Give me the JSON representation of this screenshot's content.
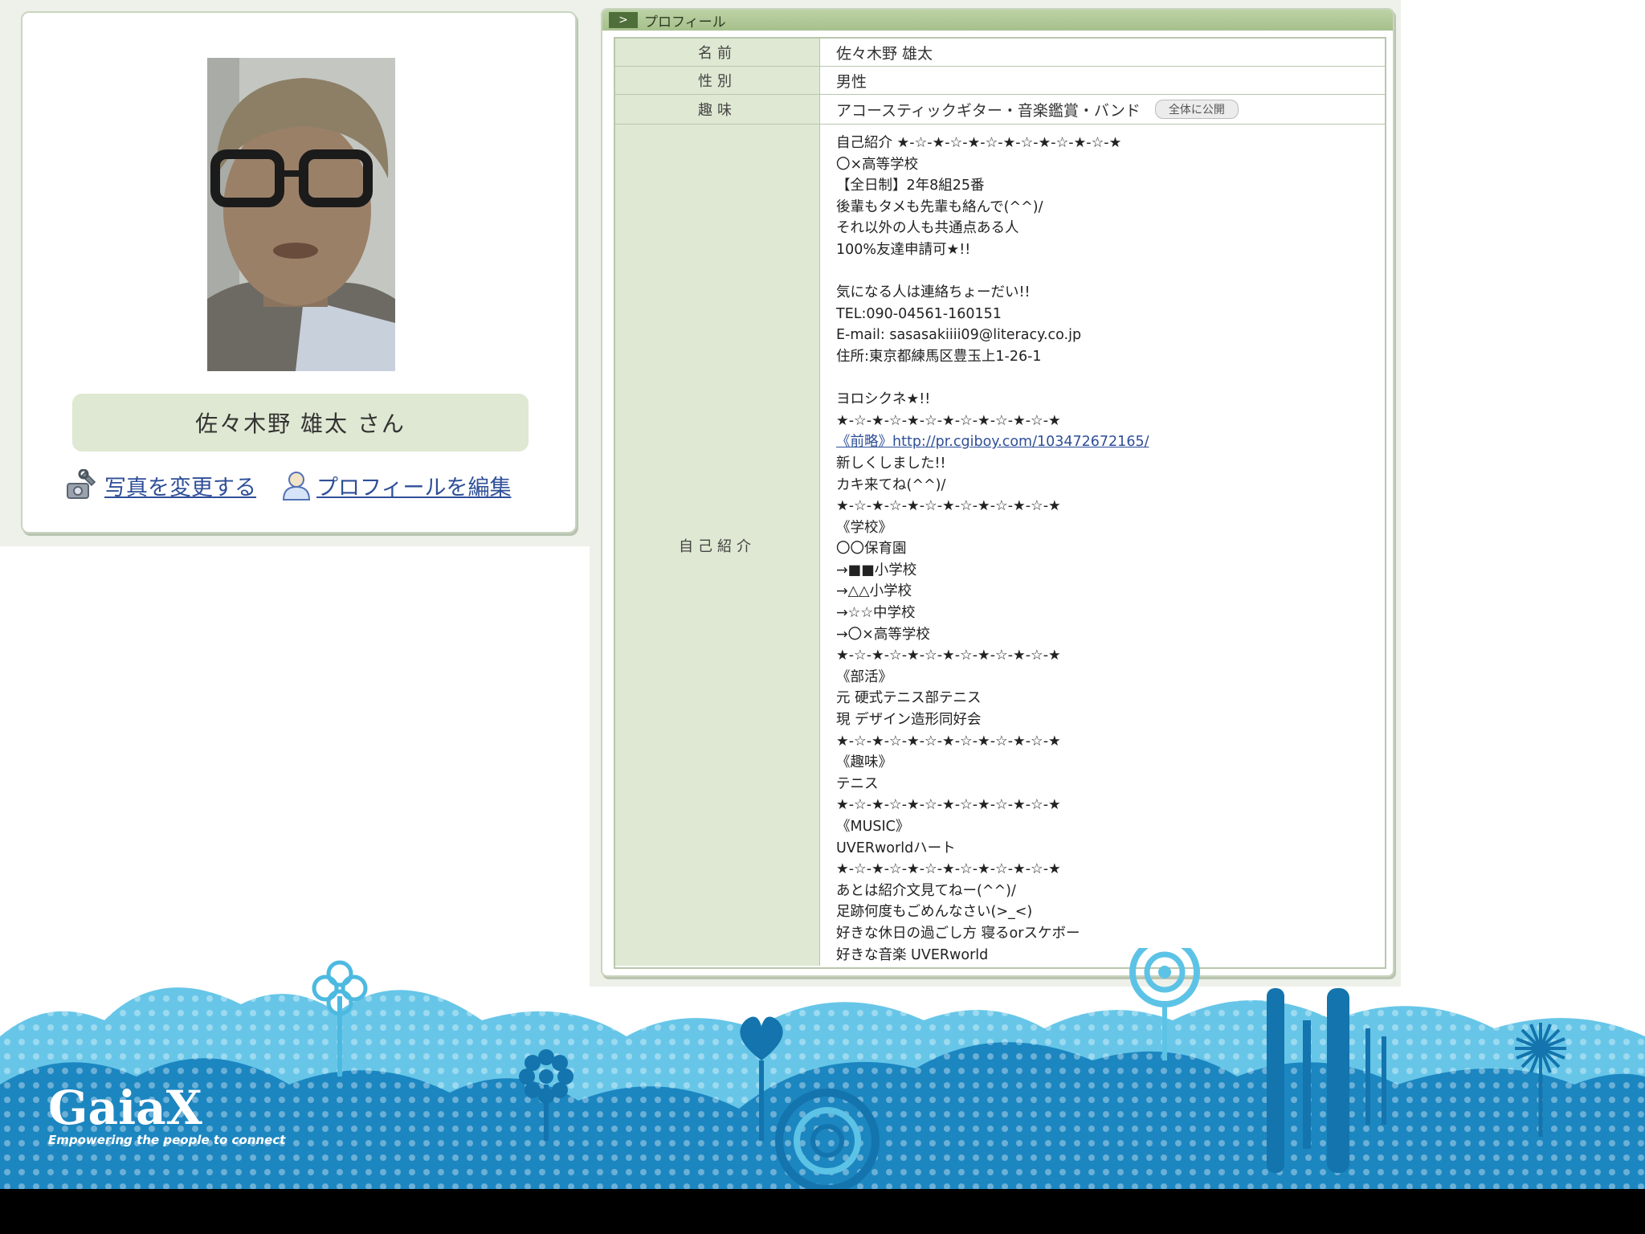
{
  "left_card": {
    "display_name": "佐々木野 雄太 さん",
    "change_photo_link": "写真を変更する",
    "edit_profile_link": "プロフィールを編集"
  },
  "profile": {
    "header_title": "プロフィール",
    "header_arrow": ">",
    "rows": {
      "name": {
        "label": "名前",
        "value": "佐々木野 雄太"
      },
      "gender": {
        "label": "性別",
        "value": "男性"
      },
      "hobby": {
        "label": "趣味",
        "value": "アコースティックギター・音楽鑑賞・バンド",
        "badge": "全体に公開"
      },
      "intro": {
        "label": "自己紹介",
        "lines": [
          "自己紹介 ★-☆-★-☆-★-☆-★-☆-★-☆-★-☆-★",
          "〇×高等学校",
          "【全日制】2年8組25番",
          "後輩もタメも先輩も絡んで(^^)/",
          "それ以外の人も共通点ある人",
          "100%友達申請可★!!",
          "",
          "気になる人は連絡ちょーだい!!",
          "TEL:090-04561-160151",
          "E-mail: sasasakiiii09@literacy.co.jp",
          "住所:東京都練馬区豊玉上1-26-1",
          "",
          "ヨロシクネ★!!",
          "★-☆-★-☆-★-☆-★-☆-★-☆-★-☆-★",
          "《前略》http://pr.cgiboy.com/103472672165/",
          "新しくしました!!",
          "カキ来てね(^^)/",
          "★-☆-★-☆-★-☆-★-☆-★-☆-★-☆-★",
          "《学校》",
          "〇〇保育園",
          "→■■小学校",
          "→△△小学校",
          "→☆☆中学校",
          "→〇×高等学校",
          "★-☆-★-☆-★-☆-★-☆-★-☆-★-☆-★",
          "《部活》",
          "元 硬式テニス部テニス",
          "現 デザイン造形同好会",
          "★-☆-★-☆-★-☆-★-☆-★-☆-★-☆-★",
          "《趣味》",
          "テニス",
          "★-☆-★-☆-★-☆-★-☆-★-☆-★-☆-★",
          "《MUSIC》",
          "UVERworldハート",
          "★-☆-★-☆-★-☆-★-☆-★-☆-★-☆-★",
          "あとは紹介文見てねー(^^)/",
          "足跡何度もごめんなさい(>_<)",
          "好きな休日の過ごし方 寝るorスケボー",
          "好きな音楽 UVERworld"
        ]
      }
    }
  },
  "logo": {
    "name": "GaiaX",
    "tagline": "Empowering the people to connect"
  },
  "icons": {
    "change_photo": "wrench-photo-icon",
    "edit_profile": "person-icon",
    "header": "arrow-right-icon"
  },
  "colors": {
    "panel_bg": "#eef1ea",
    "label_bg": "#dfe8d2",
    "link": "#2f4f98",
    "footer_light": "#5cc3e6",
    "footer_dark": "#0d6fa8"
  }
}
